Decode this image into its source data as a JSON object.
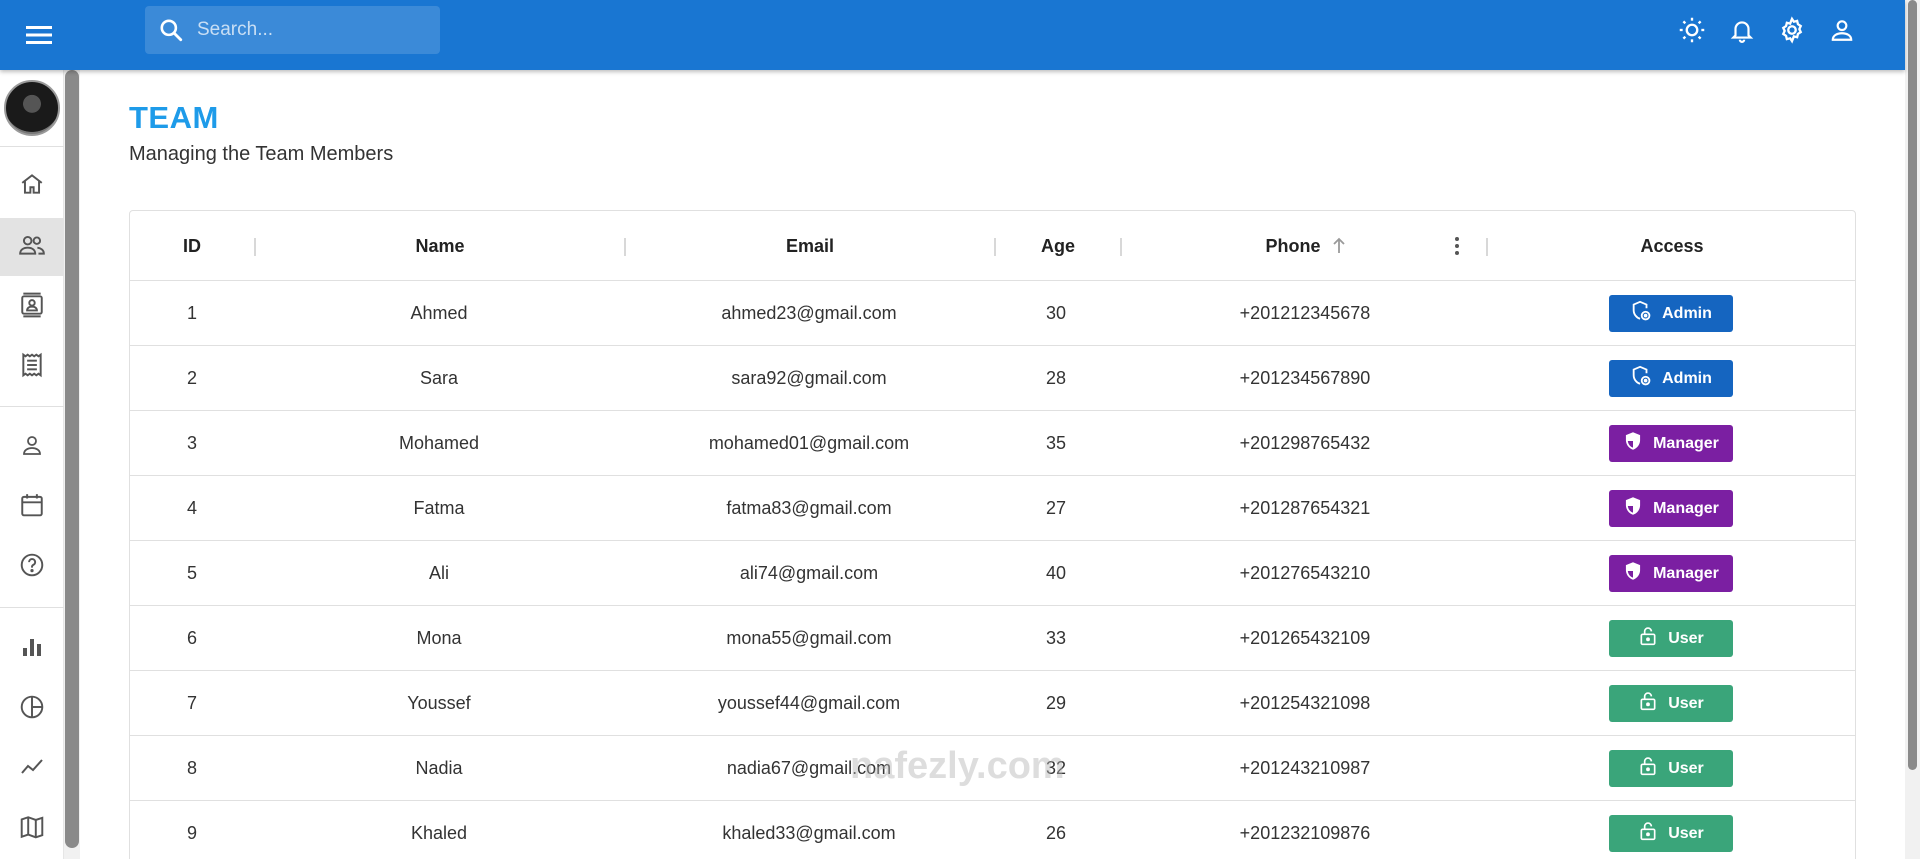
{
  "search": {
    "placeholder": "Search..."
  },
  "appbar_icons": [
    "light-mode-icon",
    "notifications-icon",
    "settings-icon",
    "person-icon"
  ],
  "sidebar": {
    "items": [
      {
        "name": "home-icon",
        "active": false
      },
      {
        "name": "team-icon",
        "active": true
      },
      {
        "name": "contacts-icon",
        "active": false
      },
      {
        "name": "invoices-icon",
        "active": false
      },
      {
        "name": "profile-icon",
        "active": false
      },
      {
        "name": "calendar-icon",
        "active": false
      },
      {
        "name": "faq-icon",
        "active": false
      },
      {
        "name": "bar-chart-icon",
        "active": false
      },
      {
        "name": "pie-chart-icon",
        "active": false
      },
      {
        "name": "line-chart-icon",
        "active": false
      },
      {
        "name": "geography-icon",
        "active": false
      }
    ]
  },
  "page": {
    "title": "TEAM",
    "subtitle": "Managing the Team Members"
  },
  "table": {
    "columns": [
      "ID",
      "Name",
      "Email",
      "Age",
      "Phone",
      "Access"
    ],
    "sort": {
      "column": "Phone",
      "direction": "asc"
    },
    "rows": [
      {
        "id": "1",
        "name": "Ahmed",
        "email": "ahmed23@gmail.com",
        "age": "30",
        "phone": "+201212345678",
        "access": "Admin"
      },
      {
        "id": "2",
        "name": "Sara",
        "email": "sara92@gmail.com",
        "age": "28",
        "phone": "+201234567890",
        "access": "Admin"
      },
      {
        "id": "3",
        "name": "Mohamed",
        "email": "mohamed01@gmail.com",
        "age": "35",
        "phone": "+201298765432",
        "access": "Manager"
      },
      {
        "id": "4",
        "name": "Fatma",
        "email": "fatma83@gmail.com",
        "age": "27",
        "phone": "+201287654321",
        "access": "Manager"
      },
      {
        "id": "5",
        "name": "Ali",
        "email": "ali74@gmail.com",
        "age": "40",
        "phone": "+201276543210",
        "access": "Manager"
      },
      {
        "id": "6",
        "name": "Mona",
        "email": "mona55@gmail.com",
        "age": "33",
        "phone": "+201265432109",
        "access": "User"
      },
      {
        "id": "7",
        "name": "Youssef",
        "email": "youssef44@gmail.com",
        "age": "29",
        "phone": "+201254321098",
        "access": "User"
      },
      {
        "id": "8",
        "name": "Nadia",
        "email": "nadia67@gmail.com",
        "age": "32",
        "phone": "+201243210987",
        "access": "User"
      },
      {
        "id": "9",
        "name": "Khaled",
        "email": "khaled33@gmail.com",
        "age": "26",
        "phone": "+201232109876",
        "access": "User"
      }
    ]
  },
  "colors": {
    "appbar": "#1976d2",
    "title": "#1e9be9",
    "admin": "#1565c0",
    "manager": "#7b1fa2",
    "user": "#3aa57a"
  },
  "watermark": "nafezly.com"
}
